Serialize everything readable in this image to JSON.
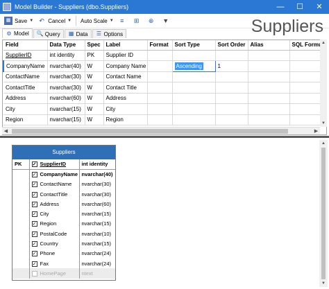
{
  "window": {
    "title": "Model Builder - Suppliers (dbo.Suppliers)",
    "minimize": "—",
    "maximize": "☐",
    "close": "✕"
  },
  "toolbar": {
    "save_label": "Save",
    "cancel_label": "Cancel",
    "autoscale_label": "Auto Scale"
  },
  "tabs": [
    {
      "label": "Model",
      "active": true
    },
    {
      "label": "Query",
      "active": false
    },
    {
      "label": "Data",
      "active": false
    },
    {
      "label": "Options",
      "active": false
    }
  ],
  "heading": "Suppliers",
  "grid": {
    "columns": [
      "Field",
      "Data Type",
      "Spec",
      "Label",
      "Format",
      "Sort Type",
      "Sort Order",
      "Alias",
      "SQL Formu"
    ],
    "rows": [
      {
        "field": "SupplierID",
        "type": "int identity",
        "spec": "PK",
        "label": "Supplier ID",
        "format": "",
        "sort_type": "",
        "sort_order": "",
        "alias": "",
        "sql": ""
      },
      {
        "field": "CompanyName",
        "type": "nvarchar(40)",
        "spec": "W",
        "label": "Company Name",
        "format": "",
        "sort_type": "Ascending",
        "sort_order": "1",
        "alias": "",
        "sql": ""
      },
      {
        "field": "ContactName",
        "type": "nvarchar(30)",
        "spec": "W",
        "label": "Contact Name",
        "format": "",
        "sort_type": "",
        "sort_order": "",
        "alias": "",
        "sql": ""
      },
      {
        "field": "ContactTitle",
        "type": "nvarchar(30)",
        "spec": "W",
        "label": "Contact Title",
        "format": "",
        "sort_type": "",
        "sort_order": "",
        "alias": "",
        "sql": ""
      },
      {
        "field": "Address",
        "type": "nvarchar(60)",
        "spec": "W",
        "label": "Address",
        "format": "",
        "sort_type": "",
        "sort_order": "",
        "alias": "",
        "sql": ""
      },
      {
        "field": "City",
        "type": "nvarchar(15)",
        "spec": "W",
        "label": "City",
        "format": "",
        "sort_type": "",
        "sort_order": "",
        "alias": "",
        "sql": ""
      },
      {
        "field": "Region",
        "type": "nvarchar(15)",
        "spec": "W",
        "label": "Region",
        "format": "",
        "sort_type": "",
        "sort_order": "",
        "alias": "",
        "sql": ""
      }
    ]
  },
  "entity": {
    "title": "Suppliers",
    "header": {
      "pk": "PK",
      "name": "SupplierID",
      "type": "int identity"
    },
    "fields": [
      {
        "name": "CompanyName",
        "type": "nvarchar(40)",
        "checked": true
      },
      {
        "name": "ContactName",
        "type": "nvarchar(30)",
        "checked": true
      },
      {
        "name": "ContactTitle",
        "type": "nvarchar(30)",
        "checked": true
      },
      {
        "name": "Address",
        "type": "nvarchar(60)",
        "checked": true
      },
      {
        "name": "City",
        "type": "nvarchar(15)",
        "checked": true
      },
      {
        "name": "Region",
        "type": "nvarchar(15)",
        "checked": true
      },
      {
        "name": "PostalCode",
        "type": "nvarchar(10)",
        "checked": true
      },
      {
        "name": "Country",
        "type": "nvarchar(15)",
        "checked": true
      },
      {
        "name": "Phone",
        "type": "nvarchar(24)",
        "checked": true
      },
      {
        "name": "Fax",
        "type": "nvarchar(24)",
        "checked": true
      },
      {
        "name": "HomePage",
        "type": "ntext",
        "checked": false
      }
    ]
  },
  "colors": {
    "titlebar": "#2b78d4",
    "entity_header": "#2f6fb5",
    "selection": "#3399ff"
  }
}
